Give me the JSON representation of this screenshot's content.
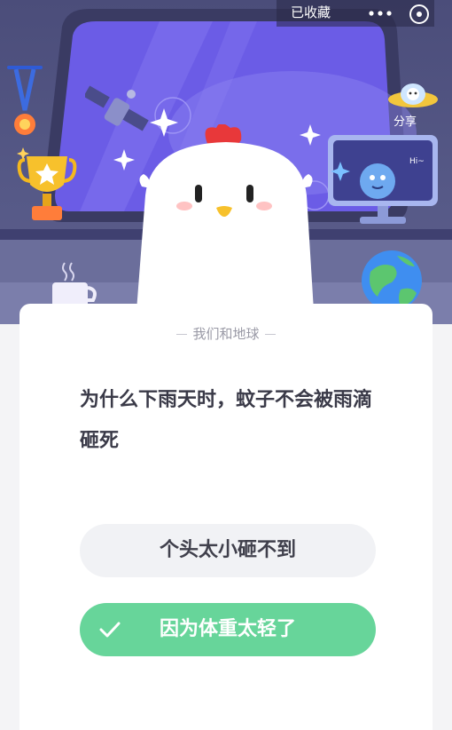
{
  "topbar": {
    "collected_label": "已收藏",
    "more_icon": "more-dots-icon",
    "close_icon": "close-circle-icon"
  },
  "hero": {
    "share_label": "分享",
    "monitor_text": "Hi~"
  },
  "card": {
    "category": "我们和地球",
    "question": "为什么下雨天时，蚊子不会被雨滴砸死",
    "options": [
      {
        "label": "个头太小砸不到",
        "selected": false
      },
      {
        "label": "因为体重太轻了",
        "selected": true
      }
    ]
  },
  "colors": {
    "correct_green": "#67d59a",
    "option_gray": "#f1f2f5",
    "hero_purple": "#4b4d7a"
  }
}
